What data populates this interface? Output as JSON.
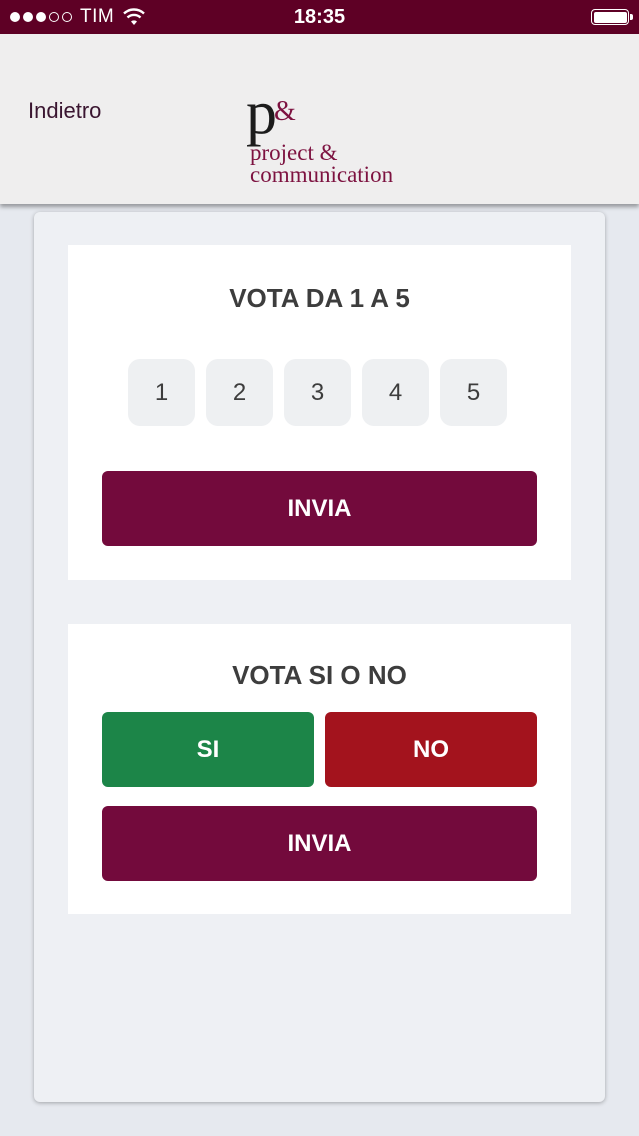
{
  "status_bar": {
    "carrier": "TIM",
    "time": "18:35",
    "signal_bars_filled": 3,
    "signal_bars_total": 5,
    "battery_level": 1.0
  },
  "nav": {
    "back_label": "Indietro",
    "logo": {
      "mark": "p",
      "mark_amp": "&",
      "line1": "project &",
      "line2": "communication"
    }
  },
  "vote_scale": {
    "title": "VOTA DA 1 A 5",
    "options": [
      "1",
      "2",
      "3",
      "4",
      "5"
    ],
    "submit_label": "INVIA"
  },
  "vote_yes_no": {
    "title": "VOTA SI O NO",
    "yes_label": "SI",
    "no_label": "NO",
    "submit_label": "INVIA"
  },
  "colors": {
    "status_bar": "#5e0025",
    "primary": "#730a3c",
    "yes": "#1c8548",
    "no": "#a3131d",
    "brand": "#7d1240"
  }
}
